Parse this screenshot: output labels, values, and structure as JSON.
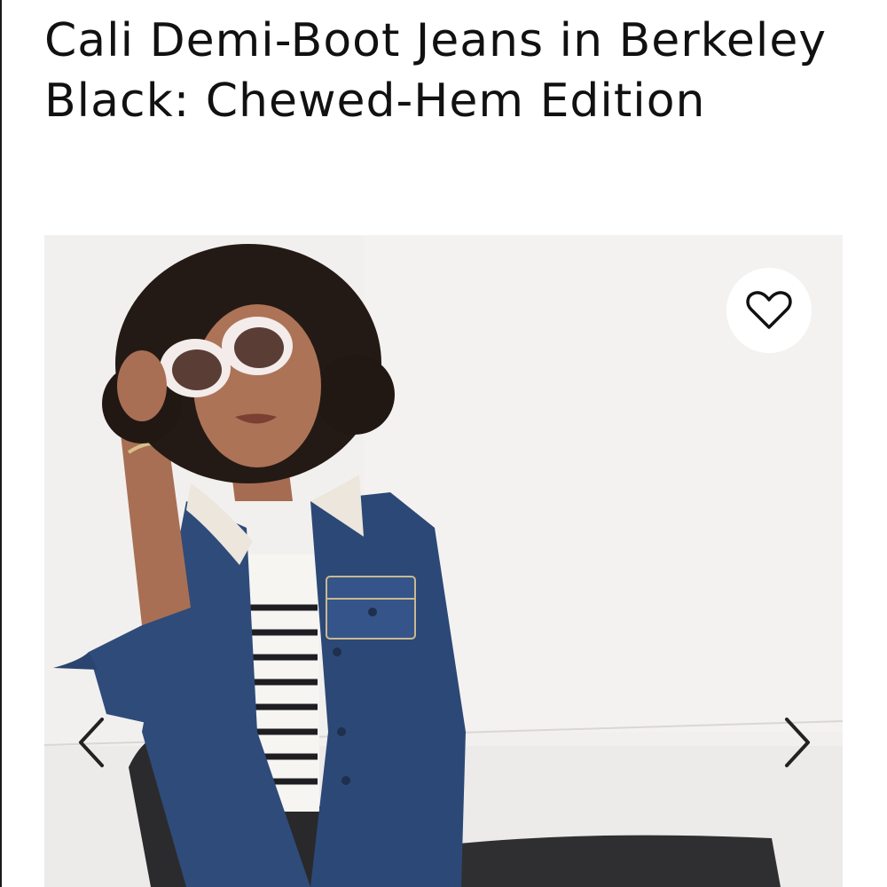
{
  "product": {
    "title": "Cali Demi-Boot Jeans in Berkeley Black: Chewed-Hem Edition"
  },
  "gallery": {
    "favorite_icon": "heart-outline-icon",
    "prev_icon": "chevron-left-icon",
    "next_icon": "chevron-right-icon"
  },
  "colors": {
    "text": "#111111",
    "photo_background": "#f1efee",
    "denim": "#2e4a78",
    "jeans": "#2b2b2d"
  }
}
